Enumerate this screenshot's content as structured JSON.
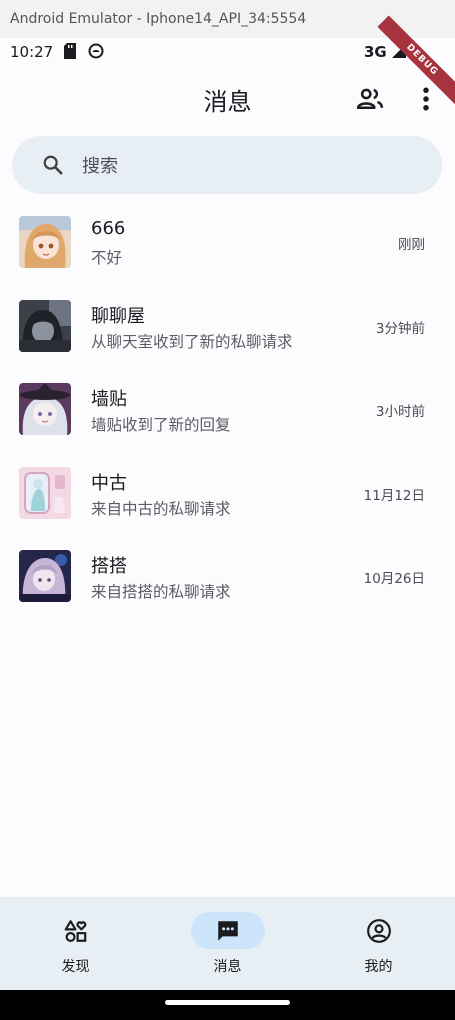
{
  "window": {
    "title": "Android Emulator - Iphone14_API_34:5554"
  },
  "status_bar": {
    "time": "10:27",
    "network": "3G",
    "icons": [
      "sd-card-icon",
      "sync-icon",
      "signal-icon",
      "battery-icon"
    ],
    "debug_banner": "DEBUG"
  },
  "app_bar": {
    "title": "消息",
    "actions": [
      "contacts-icon",
      "more-vert-icon"
    ]
  },
  "search": {
    "placeholder": "搜索",
    "value": ""
  },
  "conversations": [
    {
      "name": "666",
      "message": "不好",
      "time": "刚刚",
      "avatar": "anime-avatar-orange-hair"
    },
    {
      "name": "聊聊屋",
      "message": "从聊天室收到了新的私聊请求",
      "time": "3分钟前",
      "avatar": "anime-avatar-dark"
    },
    {
      "name": "墙贴",
      "message": "墙贴收到了新的回复",
      "time": "3小时前",
      "avatar": "anime-avatar-witch-hat"
    },
    {
      "name": "中古",
      "message": "来自中古的私聊请求",
      "time": "11月12日",
      "avatar": "anime-avatar-pink-mirror"
    },
    {
      "name": "搭搭",
      "message": "来自搭搭的私聊请求",
      "time": "10月26日",
      "avatar": "anime-avatar-lavender-hair"
    }
  ],
  "bottom_nav": {
    "selected": "消息",
    "items": [
      {
        "label": "发现",
        "icon": "discover-shapes-icon"
      },
      {
        "label": "消息",
        "icon": "chat-bubble-icon"
      },
      {
        "label": "我的",
        "icon": "account-circle-icon"
      }
    ]
  },
  "colors": {
    "background": "#fcfbfe",
    "surface_tint": "#e7eef4",
    "nav_indicator": "#cde5fb",
    "debug_ribbon": "#a6333d"
  }
}
